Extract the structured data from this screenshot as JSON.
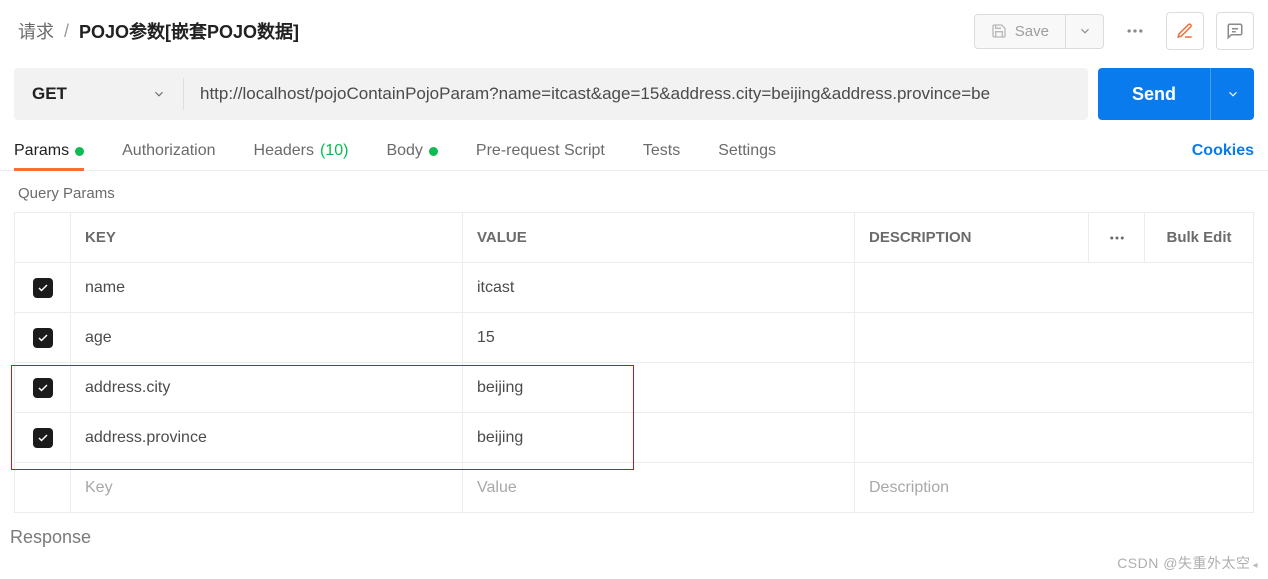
{
  "breadcrumb": {
    "root": "请求",
    "title": "POJO参数[嵌套POJO数据]"
  },
  "header": {
    "save_label": "Save"
  },
  "request": {
    "method": "GET",
    "url": "http://localhost/pojoContainPojoParam?name=itcast&age=15&address.city=beijing&address.province=be",
    "send_label": "Send"
  },
  "tabs": {
    "params": "Params",
    "authorization": "Authorization",
    "headers": "Headers",
    "headers_count": "(10)",
    "body": "Body",
    "prerequest": "Pre-request Script",
    "tests": "Tests",
    "settings": "Settings",
    "cookies": "Cookies"
  },
  "section": {
    "query_params": "Query Params"
  },
  "columns": {
    "key": "KEY",
    "value": "VALUE",
    "description": "DESCRIPTION",
    "bulk": "Bulk Edit"
  },
  "rows": [
    {
      "checked": true,
      "key": "name",
      "value": "itcast"
    },
    {
      "checked": true,
      "key": "age",
      "value": "15"
    },
    {
      "checked": true,
      "key": "address.city",
      "value": "beijing"
    },
    {
      "checked": true,
      "key": "address.province",
      "value": "beijing"
    }
  ],
  "placeholders": {
    "key": "Key",
    "value": "Value",
    "description": "Description"
  },
  "response": {
    "label": "Response"
  },
  "watermark": "CSDN @失重外太空"
}
